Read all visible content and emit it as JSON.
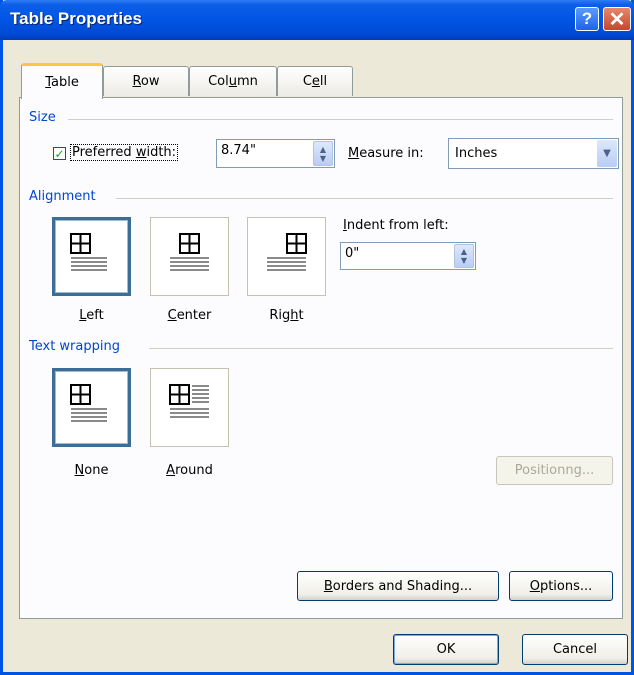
{
  "dialog": {
    "title": "Table Properties"
  },
  "tabs": [
    {
      "label": "Table",
      "mnemonic": "T",
      "rest": "able",
      "active": true
    },
    {
      "label": "Row",
      "mnemonic": "R",
      "rest": "ow",
      "active": false
    },
    {
      "label": "Column",
      "pre": "Col",
      "mnemonic": "u",
      "rest": "mn",
      "active": false
    },
    {
      "label": "Cell",
      "pre": "C",
      "mnemonic": "e",
      "rest": "ll",
      "active": false
    }
  ],
  "size": {
    "section_label": "Size",
    "preferred_width_checked": true,
    "preferred_width_label_pre": "Preferred ",
    "preferred_width_mnemonic": "w",
    "preferred_width_label_post": "idth:",
    "preferred_width_value": "8.74\"",
    "measure_in_mnemonic": "M",
    "measure_in_label_post": "easure in:",
    "measure_in_value": "Inches"
  },
  "alignment": {
    "section_label": "Alignment",
    "options": [
      {
        "mnemonic": "L",
        "rest": "eft",
        "selected": true
      },
      {
        "mnemonic": "C",
        "rest": "enter",
        "selected": false
      },
      {
        "pre": "Rig",
        "mnemonic": "h",
        "rest": "t",
        "selected": false
      }
    ],
    "indent_label_pre": "",
    "indent_mnemonic": "I",
    "indent_label_post": "ndent from left:",
    "indent_value": "0\""
  },
  "text_wrapping": {
    "section_label": "Text wrapping",
    "options": [
      {
        "mnemonic": "N",
        "rest": "one",
        "selected": true
      },
      {
        "mnemonic": "A",
        "rest": "round",
        "selected": false
      }
    ],
    "positioning_label": "Positionng..."
  },
  "buttons": {
    "borders_mnemonic": "B",
    "borders_rest": "orders and Shading...",
    "options_mnemonic": "O",
    "options_rest": "ptions...",
    "ok": "OK",
    "cancel": "Cancel"
  },
  "icons": {
    "help": "help-icon",
    "close": "close-icon",
    "checkbox": "check-icon",
    "spinner": "spin-arrows-icon",
    "dropdown": "chevron-down-icon"
  },
  "colors": {
    "titlebar": "#0055e5",
    "dialog_bg": "#ece9d8",
    "panel_bg": "#fcfcfe",
    "section_text": "#0046d5",
    "selected_border": "#3a6e98"
  }
}
